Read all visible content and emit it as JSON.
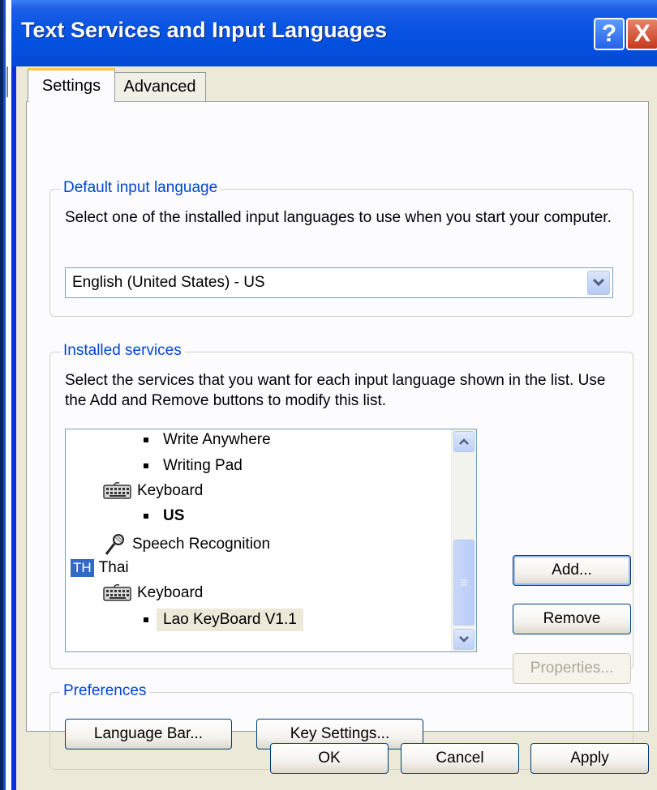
{
  "window": {
    "title": "Text Services and Input Languages",
    "help_glyph": "?",
    "close_glyph": "X"
  },
  "tabs": [
    {
      "label": "Settings",
      "active": true
    },
    {
      "label": "Advanced",
      "active": false
    }
  ],
  "default_input": {
    "group_label": "Default input language",
    "description": "Select one of the installed input languages to use when you start your computer.",
    "selected": "English (United States) - US"
  },
  "installed_services": {
    "group_label": "Installed services",
    "description": "Select the services that you want for each input language shown in the list. Use the Add and Remove buttons to modify this list.",
    "items": [
      {
        "label": "Write Anywhere",
        "kind": "bullet"
      },
      {
        "label": "Writing Pad",
        "kind": "bullet"
      },
      {
        "label": "Keyboard",
        "kind": "keyboard-icon"
      },
      {
        "label": "US",
        "kind": "bullet-bold"
      },
      {
        "label": "Speech Recognition",
        "kind": "microphone-icon"
      },
      {
        "label": "Thai",
        "kind": "language-badge",
        "badge": "TH"
      },
      {
        "label": "Keyboard",
        "kind": "keyboard-icon"
      },
      {
        "label": "Lao KeyBoard V1.1",
        "kind": "bullet-selected"
      }
    ],
    "buttons": {
      "add": "Add...",
      "remove": "Remove",
      "properties": "Properties..."
    }
  },
  "preferences": {
    "group_label": "Preferences",
    "language_bar": "Language Bar...",
    "key_settings": "Key Settings..."
  },
  "footer": {
    "ok": "OK",
    "cancel": "Cancel",
    "apply": "Apply"
  },
  "colors": {
    "title_bar": "#0450de",
    "group_label": "#0046d5",
    "dialog_bg": "#ece9d8",
    "badge_bg": "#316ac5"
  }
}
